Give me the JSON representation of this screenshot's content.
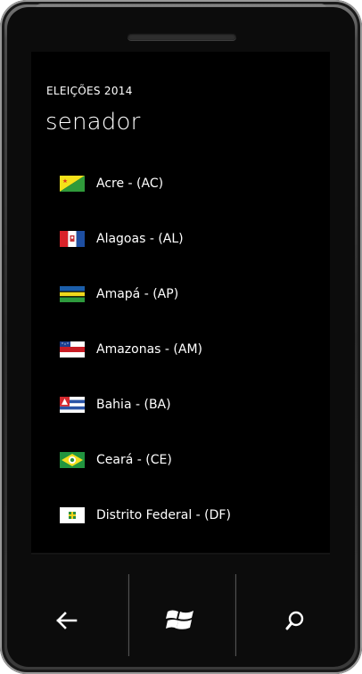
{
  "header": {
    "app_title": "ELEIÇÕES 2014",
    "page_title": "senador"
  },
  "states": [
    {
      "label": "Acre - (AC)",
      "flag": "acre-flag"
    },
    {
      "label": "Alagoas - (AL)",
      "flag": "alagoas-flag"
    },
    {
      "label": "Amapá - (AP)",
      "flag": "amapa-flag"
    },
    {
      "label": "Amazonas - (AM)",
      "flag": "amazonas-flag"
    },
    {
      "label": "Bahia - (BA)",
      "flag": "bahia-flag"
    },
    {
      "label": "Ceará - (CE)",
      "flag": "ceara-flag"
    },
    {
      "label": "Distrito Federal - (DF)",
      "flag": "distrito-federal-flag"
    }
  ],
  "hardware_buttons": {
    "back": "back-arrow-icon",
    "start": "windows-logo-icon",
    "search": "search-icon"
  }
}
